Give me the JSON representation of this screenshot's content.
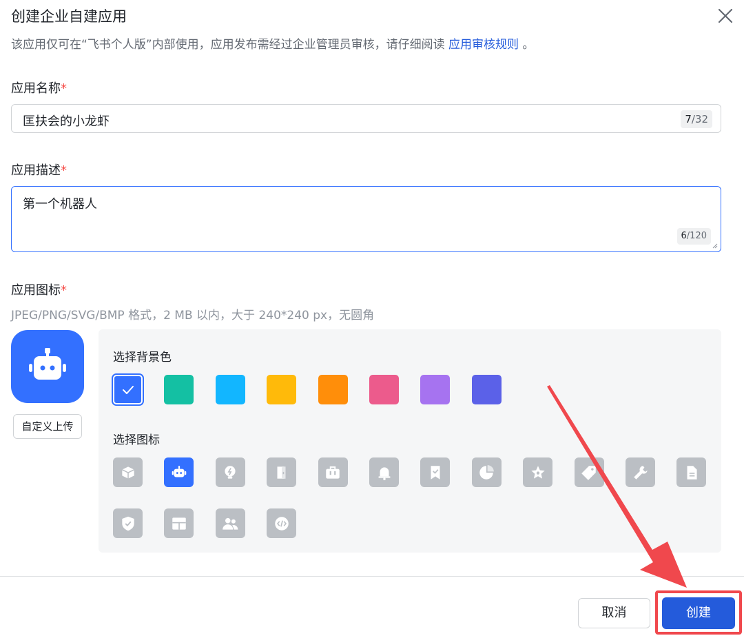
{
  "dialog": {
    "title": "创建企业自建应用",
    "subtitle_prefix": "该应用仅可在“飞书个人版”内部使用，应用发布需经过企业管理员审核，请仔细阅读 ",
    "subtitle_link": "应用审核规则",
    "subtitle_suffix": " 。",
    "close_icon": "close-icon"
  },
  "form": {
    "required_mark": "*",
    "name": {
      "label": "应用名称",
      "value": "匡扶会的小龙虾",
      "count": "7",
      "max": "/32"
    },
    "description": {
      "label": "应用描述",
      "value": "第一个机器人",
      "count": "6",
      "max": "/120"
    },
    "icon": {
      "label": "应用图标",
      "hint": "JPEG/PNG/SVG/BMP 格式，2 MB 以内，大于 240*240 px，无圆角",
      "current_icon": "robot-icon",
      "upload_label": "自定义上传"
    }
  },
  "picker": {
    "bg_label": "选择背景色",
    "icon_label": "选择图标",
    "colors": [
      "#3370ff",
      "#14c0a3",
      "#12b6ff",
      "#ffba0a",
      "#ff8e0a",
      "#ec5b8c",
      "#a673f0",
      "#5b61e8"
    ],
    "selected_color_index": 0,
    "icons": [
      "cube-icon",
      "robot-icon",
      "lightbulb-icon",
      "door-icon",
      "briefcase-icon",
      "bell-icon",
      "bookmark-icon",
      "pie-chart-icon",
      "star-icon",
      "tag-icon",
      "wrench-icon",
      "document-icon",
      "shield-icon",
      "layout-icon",
      "users-icon",
      "code-icon"
    ],
    "selected_icon_index": 1
  },
  "footer": {
    "cancel_label": "取消",
    "create_label": "创建"
  },
  "annotation_color": "#f0484d"
}
